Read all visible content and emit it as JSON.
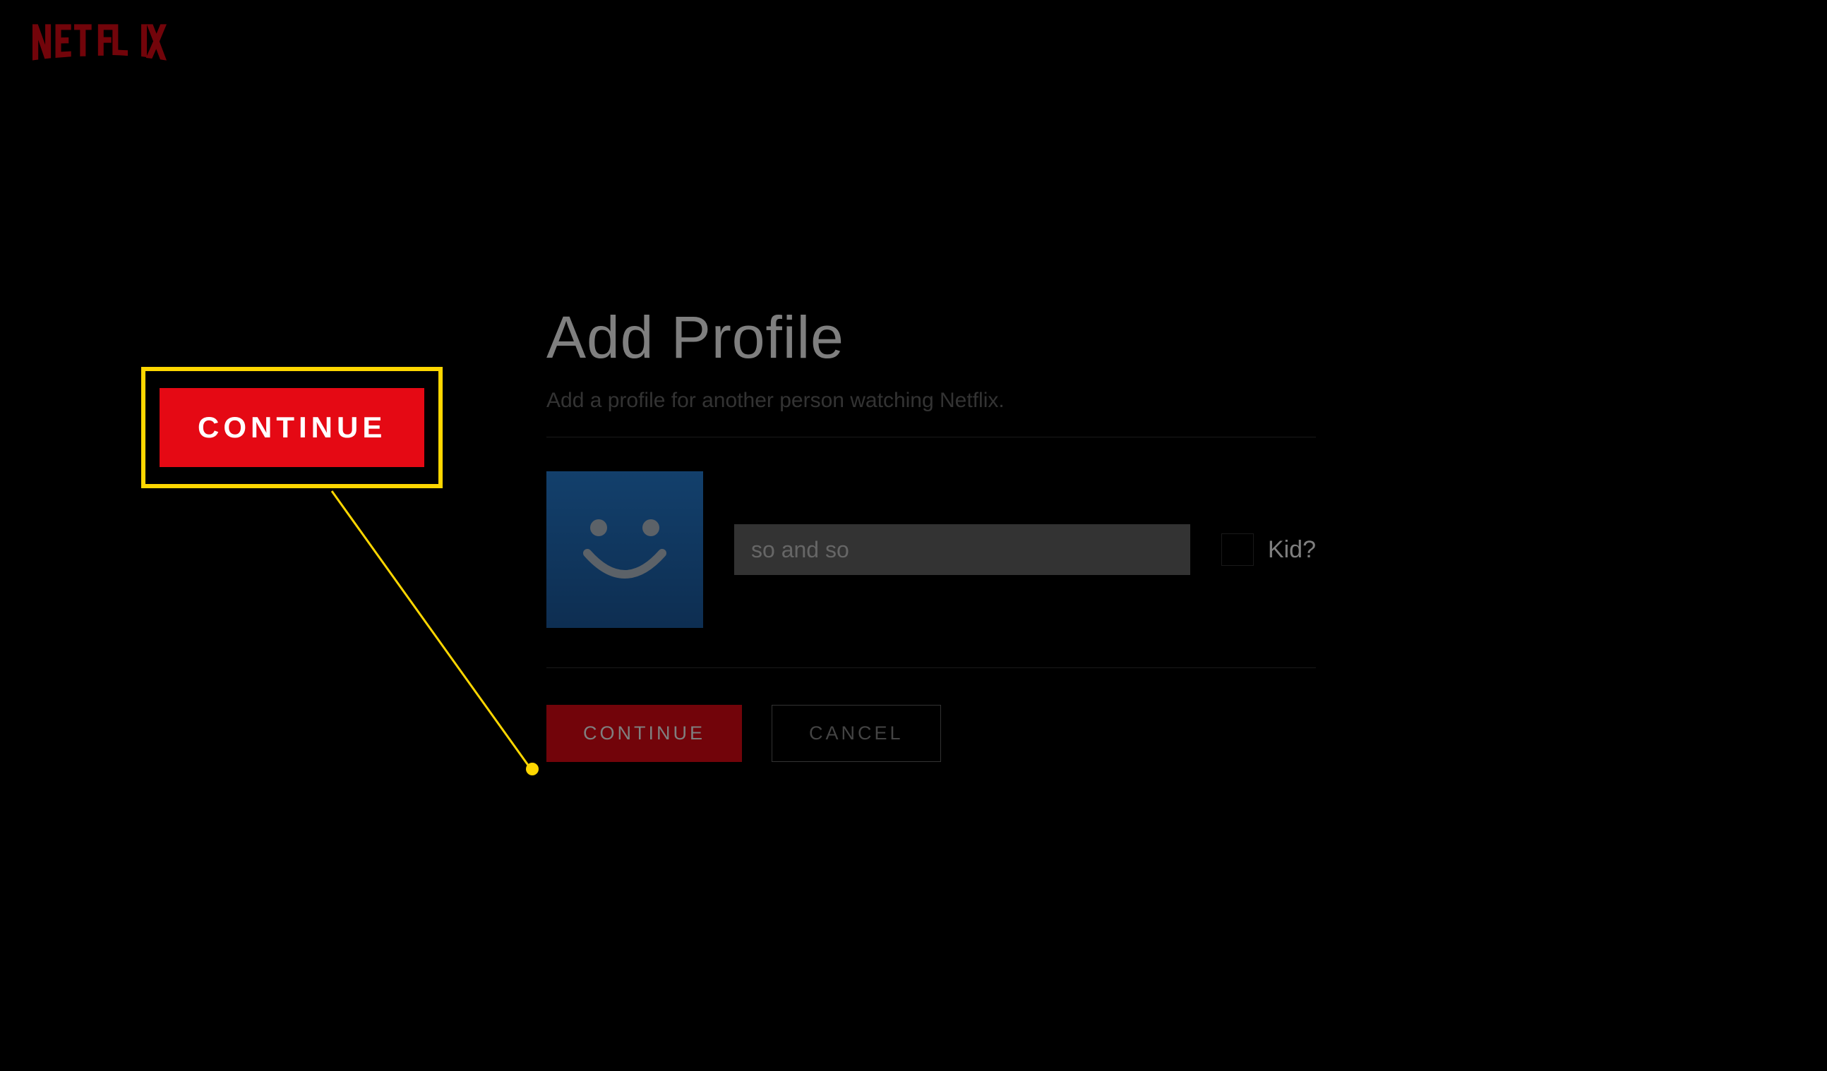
{
  "brand": "NETFLIX",
  "page": {
    "title": "Add Profile",
    "subtitle": "Add a profile for another person watching Netflix."
  },
  "form": {
    "name_value": "so and so",
    "kid_label": "Kid?"
  },
  "actions": {
    "continue_label": "CONTINUE",
    "cancel_label": "CANCEL"
  },
  "callout": {
    "button_label": "CONTINUE"
  }
}
